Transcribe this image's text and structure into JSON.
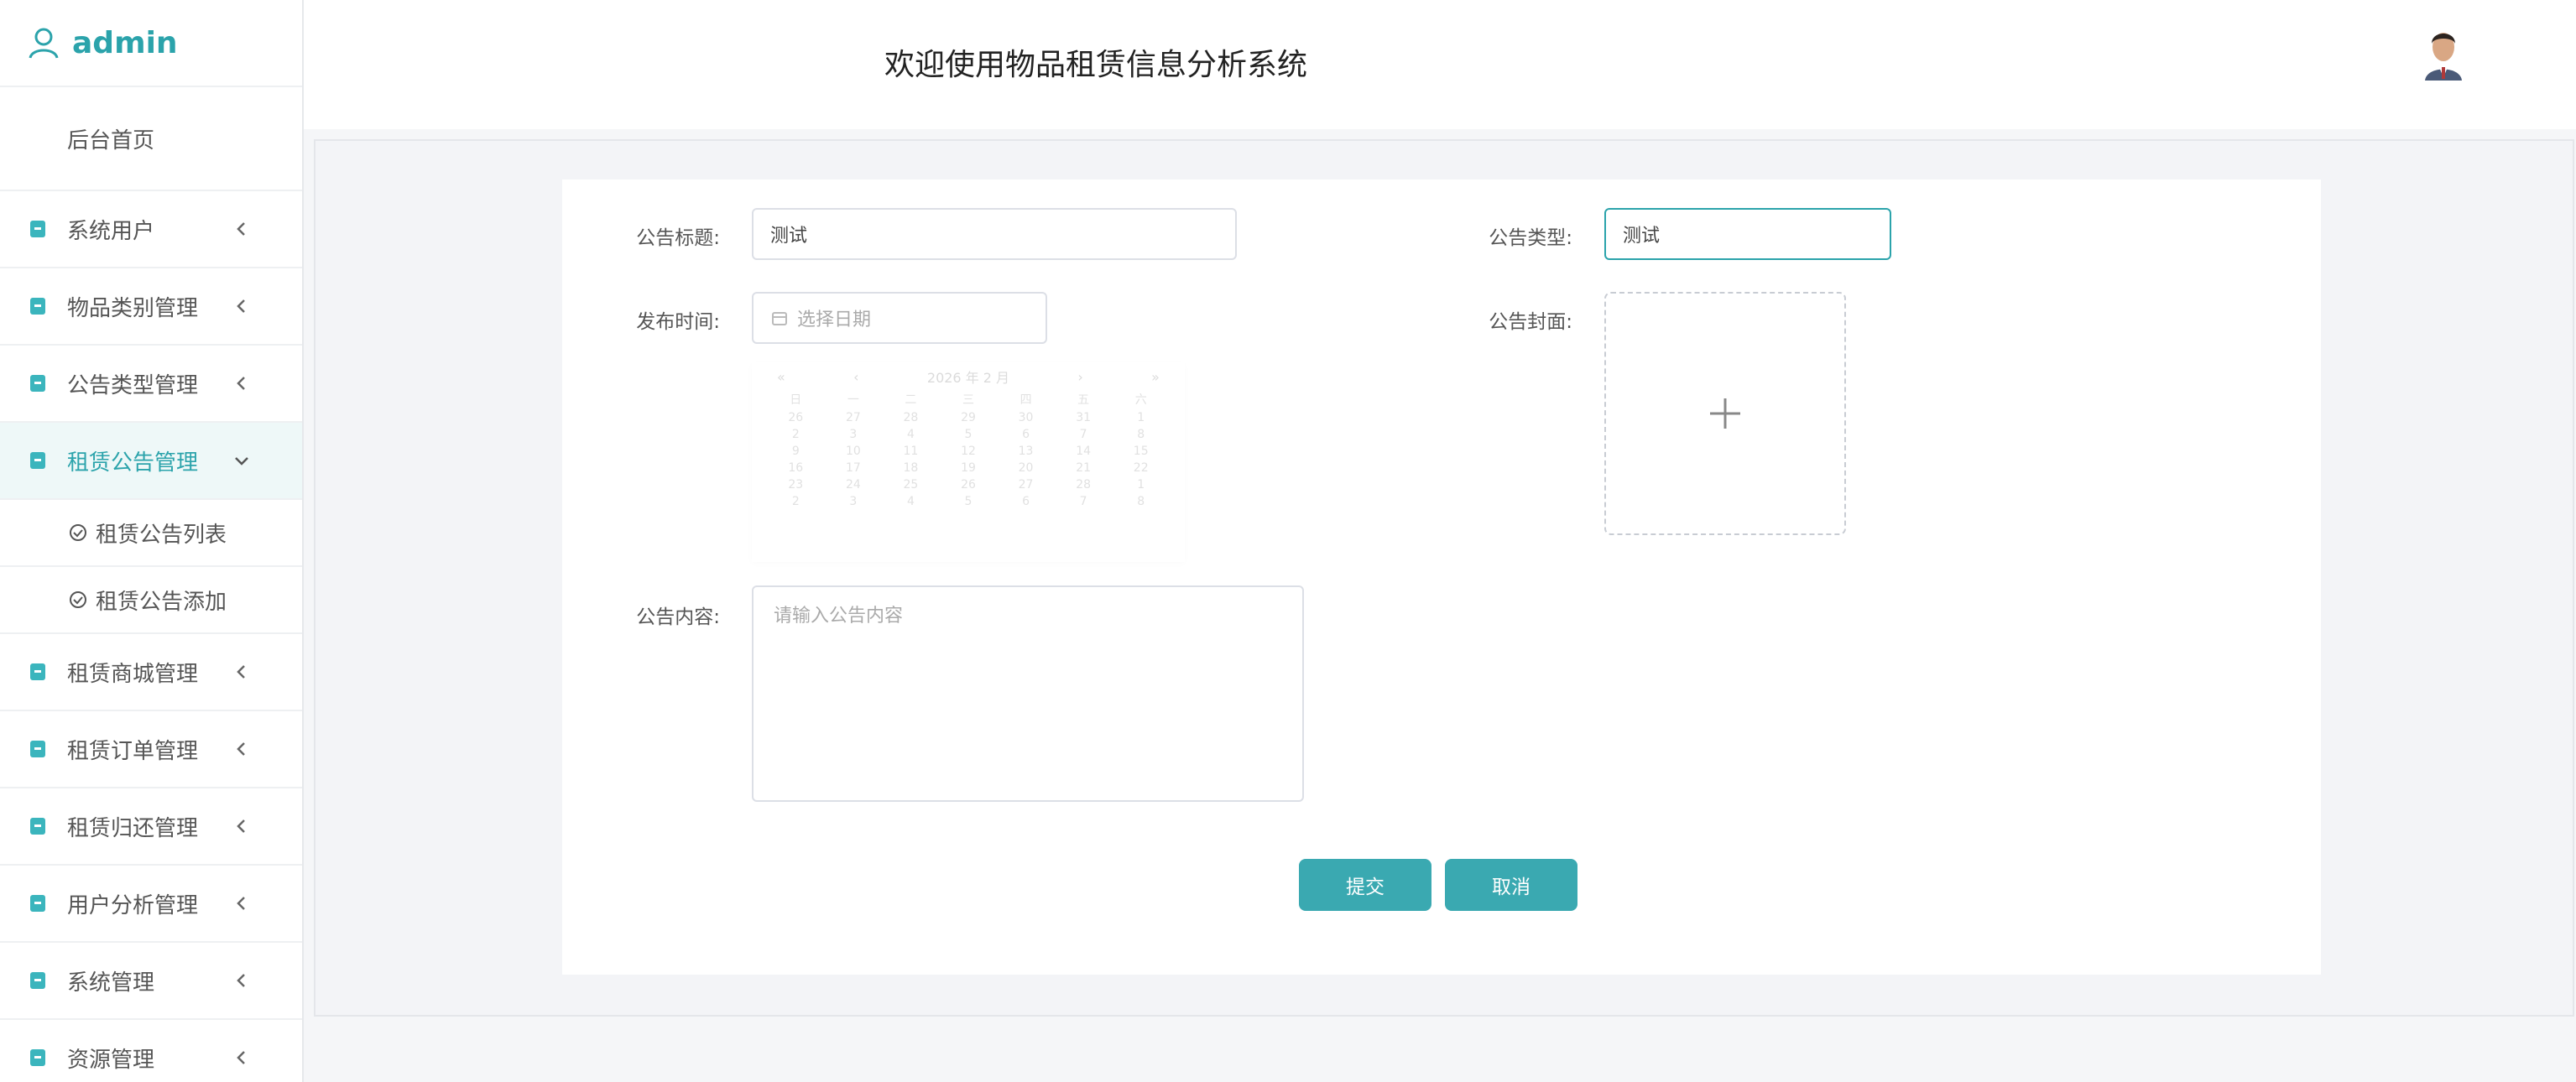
{
  "sidebar": {
    "username": "admin",
    "home": "后台首页",
    "items": [
      {
        "label": "系统用户"
      },
      {
        "label": "物品类别管理"
      },
      {
        "label": "公告类型管理"
      },
      {
        "label": "租赁公告管理"
      },
      {
        "label": "租赁商城管理"
      },
      {
        "label": "租赁订单管理"
      },
      {
        "label": "租赁归还管理"
      },
      {
        "label": "用户分析管理"
      },
      {
        "label": "系统管理"
      },
      {
        "label": "资源管理"
      }
    ],
    "subitems": [
      {
        "label": "租赁公告列表"
      },
      {
        "label": "租赁公告添加"
      }
    ]
  },
  "header": {
    "title": "欢迎使用物品租赁信息分析系统"
  },
  "form": {
    "title_label": "公告标题:",
    "title_value": "测试",
    "type_label": "公告类型:",
    "type_value": "测试",
    "time_label": "发布时间:",
    "time_placeholder": "选择日期",
    "cover_label": "公告封面:",
    "content_label": "公告内容:",
    "content_placeholder": "请输入公告内容",
    "submit_label": "提交",
    "cancel_label": "取消"
  },
  "calendar": {
    "header": "2026 年 2 月",
    "weekdays": [
      "日",
      "一",
      "二",
      "三",
      "四",
      "五",
      "六"
    ],
    "days": [
      "26",
      "27",
      "28",
      "29",
      "30",
      "31",
      "1",
      "2",
      "3",
      "4",
      "5",
      "6",
      "7",
      "8",
      "9",
      "10",
      "11",
      "12",
      "13",
      "14",
      "15",
      "16",
      "17",
      "18",
      "19",
      "20",
      "21",
      "22",
      "23",
      "24",
      "25",
      "26",
      "27",
      "28",
      "1",
      "2",
      "3",
      "4",
      "5",
      "6",
      "7",
      "8"
    ]
  },
  "colors": {
    "accent": "#2ba3ab",
    "button": "#3aa9b1"
  }
}
